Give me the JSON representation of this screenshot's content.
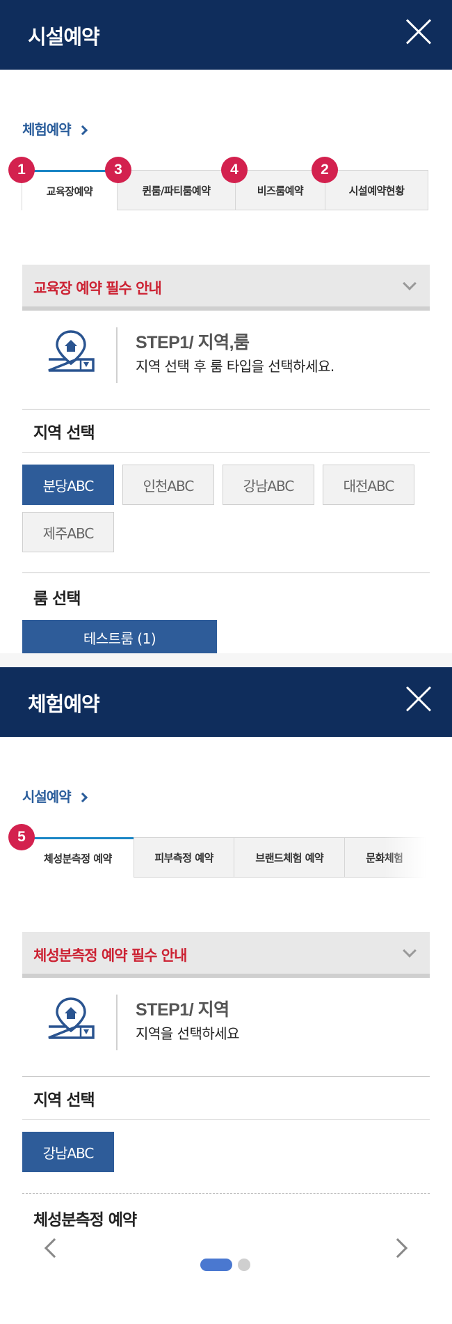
{
  "panel1": {
    "header_title": "시설예약",
    "breadcrumb": "체험예약",
    "tabs": [
      {
        "label": "교육장예약",
        "active": true
      },
      {
        "label": "퀸룸/파티룸예약",
        "active": false
      },
      {
        "label": "비즈룸예약",
        "active": false
      },
      {
        "label": "시설예약현황",
        "active": false
      }
    ],
    "badges": [
      "1",
      "3",
      "4",
      "2"
    ],
    "notice": "교육장 예약 필수 안내",
    "step_title": "STEP1/ 지역,룸",
    "step_desc": "지역 선택 후 룸 타입을 선택하세요.",
    "region_title": "지역 선택",
    "regions": [
      {
        "label": "분당ABC",
        "selected": true
      },
      {
        "label": "인천ABC",
        "selected": false
      },
      {
        "label": "강남ABC",
        "selected": false
      },
      {
        "label": "대전ABC",
        "selected": false
      },
      {
        "label": "제주ABC",
        "selected": false
      }
    ],
    "room_title": "룸 선택",
    "room_button": "테스트룸 (1)"
  },
  "panel2": {
    "header_title": "체험예약",
    "breadcrumb": "시설예약",
    "tabs": [
      {
        "label": "체성분측정 예약",
        "active": true
      },
      {
        "label": "피부측정 예약",
        "active": false
      },
      {
        "label": "브랜드체험 예약",
        "active": false
      },
      {
        "label": "문화체험",
        "active": false
      }
    ],
    "badge": "5",
    "notice": "체성분측정 예약 필수 안내",
    "step_title": "STEP1/ 지역",
    "step_desc": "지역을 선택하세요",
    "region_title": "지역 선택",
    "regions": [
      {
        "label": "강남ABC",
        "selected": true
      }
    ],
    "booking_title": "체성분측정 예약",
    "pager": {
      "count": 2,
      "active": 1
    }
  },
  "colors": {
    "header": "#0f2d5c",
    "accent": "#2e5c99",
    "badge": "#d3214e",
    "notice_text": "#cc2233",
    "tab_active_border": "#1b86c5"
  },
  "icons": [
    "close-icon",
    "chevron-right-icon",
    "chevron-down-icon",
    "location-home-icon",
    "arrow-left-icon",
    "arrow-right-icon"
  ]
}
